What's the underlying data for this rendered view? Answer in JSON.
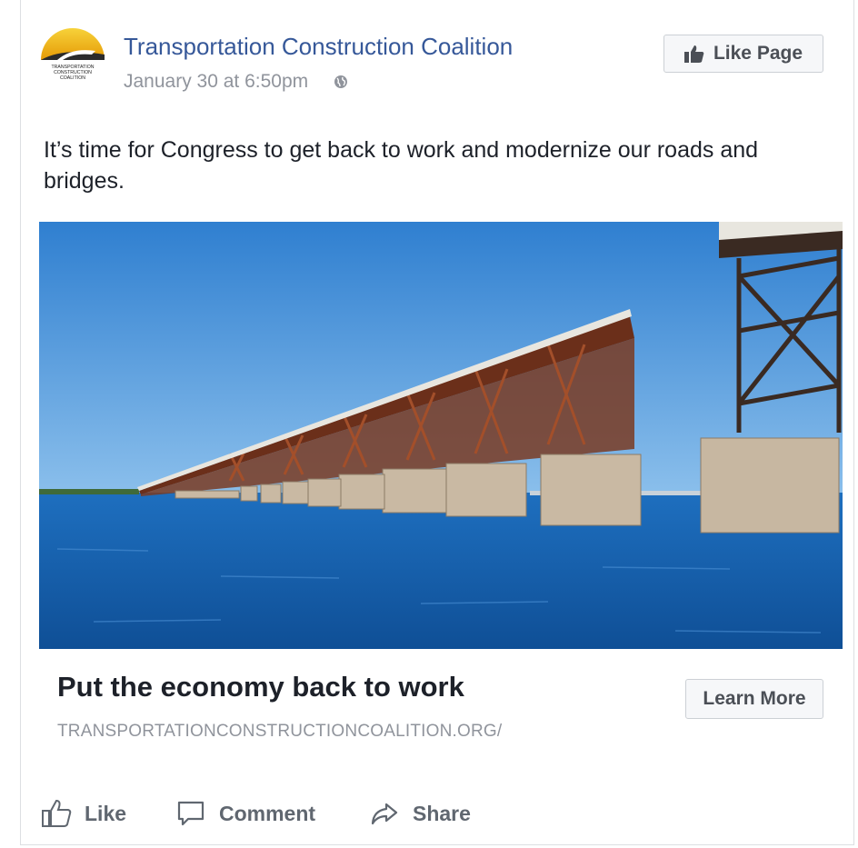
{
  "post": {
    "page_name": "Transportation Construction Coalition",
    "timestamp": "January 30 at 6:50pm",
    "audience_icon": "globe-icon",
    "like_page_label": "Like Page",
    "text": "It’s time for Congress to get back to work and modernize our roads and bridges.",
    "logo_text": [
      "TRANSPORTATION",
      "CONSTRUCTION",
      "COALITION"
    ]
  },
  "link": {
    "title": "Put the economy back to work",
    "url": "TRANSPORTATIONCONSTRUCTIONCOALITION.ORG/",
    "cta_label": "Learn More"
  },
  "actions": {
    "like": "Like",
    "comment": "Comment",
    "share": "Share"
  },
  "colors": {
    "link_blue": "#365899",
    "meta_gray": "#90949c",
    "button_bg": "#f6f7f9",
    "button_border": "#ccd0d5",
    "action_gray": "#606770",
    "logo_yellow": "#f2b705",
    "sky": "#4a90d6",
    "water": "#1f6fb5",
    "rust": "#7a3b22"
  }
}
